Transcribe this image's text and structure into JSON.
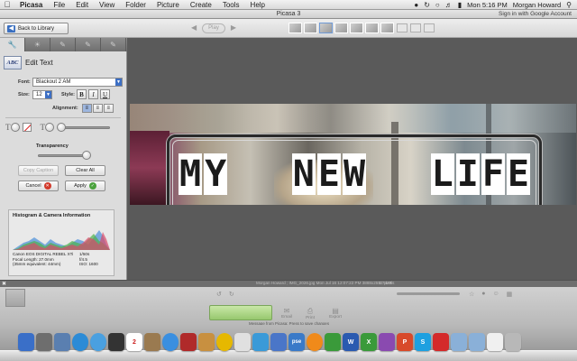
{
  "menubar": {
    "app_name": "Picasa",
    "menus": [
      "File",
      "Edit",
      "View",
      "Folder",
      "Picture",
      "Create",
      "Tools",
      "Help"
    ],
    "clock": "Mon 5:16 PM",
    "user": "Morgan Howard"
  },
  "window": {
    "title": "Picasa 3",
    "signin": "Sign in with Google Account"
  },
  "toolbar": {
    "back_label": "Back to Library",
    "play_label": "Play"
  },
  "panel": {
    "tabs": [
      "wrench",
      "bulb",
      "brush",
      "brush2",
      "brush3"
    ],
    "edit_text_icon": "ABC",
    "edit_text_title": "Edit Text",
    "font_label": "Font:",
    "font_value": "Blackout 2 AM",
    "size_label": "Size:",
    "size_value": "12",
    "style_label": "Style:",
    "style_bold": "B",
    "style_italic": "I",
    "style_underline": "U",
    "alignment_label": "Alignment:",
    "transparency_label": "Transparency",
    "copy_caption": "Copy Caption",
    "clear_all": "Clear All",
    "cancel": "Cancel",
    "apply": "Apply",
    "histogram_title": "Histogram & Camera Information",
    "camera_model": "Canon EOS DIGITAL REBEL XTi",
    "focal_length": "Focal Length: 27.0mm",
    "equivalent": "(35mm equivalent: 44mm)",
    "shutter": "1/50s",
    "aperture": "f/4.5",
    "iso": "ISO: 1600"
  },
  "photo": {
    "overlay_words": [
      "MY",
      "NEW",
      "LIFE"
    ]
  },
  "status": {
    "info": "Morgan Howard ; IMG_2026.jpg   Mon Jul 16 12:07:22 PM   3888x2592 pixels",
    "size": "2.7 MB"
  },
  "bottom": {
    "share_items": [
      "Email",
      "Print",
      "Export"
    ],
    "note": "Message from Picasa: Press to save changes"
  },
  "colors": {
    "accent_blue": "#3d6fc4",
    "cancel_red": "#d23a2b",
    "apply_green": "#4aa23c"
  }
}
